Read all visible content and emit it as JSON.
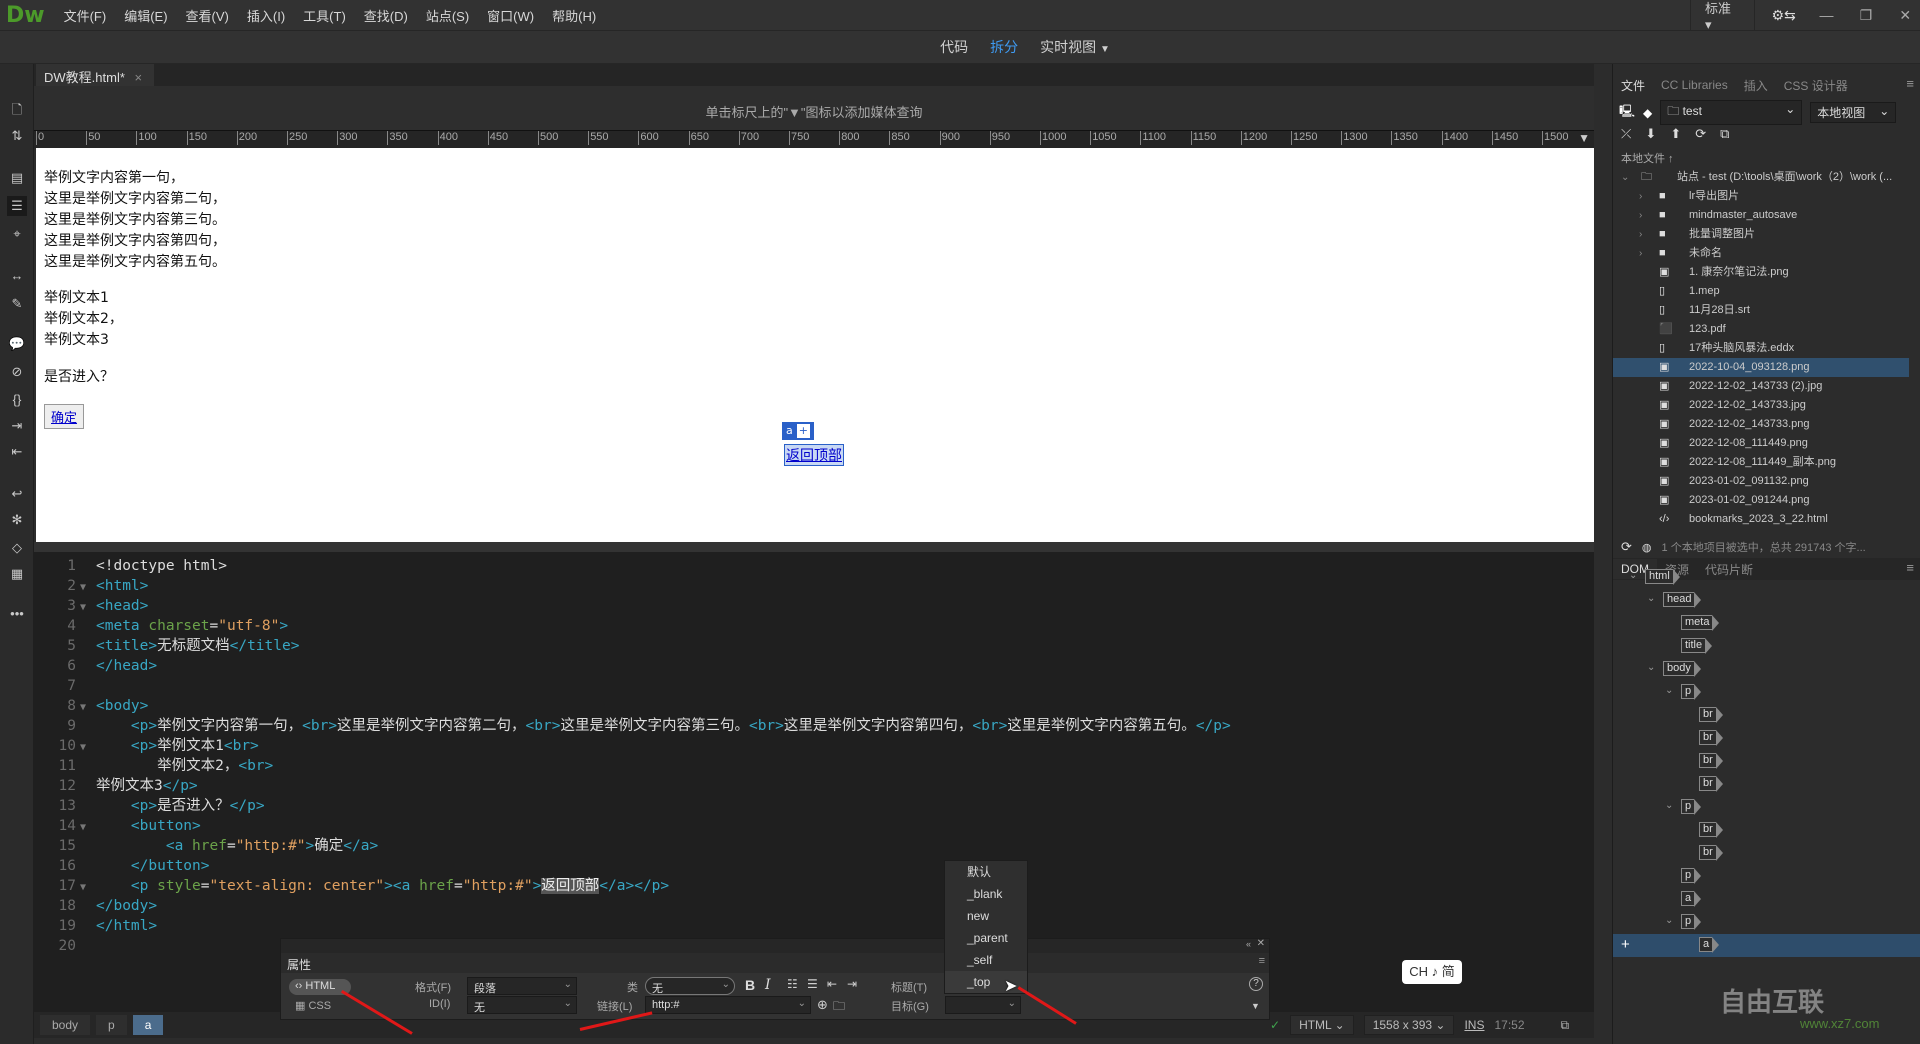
{
  "app": {
    "logo": "Dw",
    "workspace": "标准"
  },
  "menu": [
    "文件(F)",
    "编辑(E)",
    "查看(V)",
    "插入(I)",
    "工具(T)",
    "查找(D)",
    "站点(S)",
    "窗口(W)",
    "帮助(H)"
  ],
  "view_switch": {
    "code": "代码",
    "split": "拆分",
    "live": "实时视图",
    "active": "拆分"
  },
  "document_tab": {
    "name": "DW教程.html*",
    "close": "×"
  },
  "media_query_hint": "单击标尺上的\"▼\"图标以添加媒体查询",
  "ruler_ticks": [
    "0",
    "50",
    "100",
    "150",
    "200",
    "250",
    "300",
    "350",
    "400",
    "450",
    "500",
    "550",
    "600",
    "650",
    "700",
    "750",
    "800",
    "850",
    "900",
    "950",
    "1000",
    "1050",
    "1100",
    "1150",
    "1200",
    "1250",
    "1300",
    "1350",
    "1400",
    "1450",
    "1500"
  ],
  "design": {
    "para1": [
      "举例文字内容第一句，",
      "这里是举例文字内容第二句，",
      "这里是举例文字内容第三句。",
      "这里是举例文字内容第四句，",
      "这里是举例文字内容第五句。"
    ],
    "para2": [
      "举例文本1",
      "举例文本2，",
      "举例文本3"
    ],
    "para3": "是否进入？",
    "button_label": "确定",
    "selected_tag": "a",
    "selected_tag_add": "+",
    "back_to_top": "返回顶部"
  },
  "code_lines": [
    {
      "n": "1",
      "fold": "",
      "indent": "",
      "parts": [
        [
          "tx",
          "<!doctype html>"
        ]
      ]
    },
    {
      "n": "2",
      "fold": "▼",
      "indent": "",
      "parts": [
        [
          "tg",
          "<html>"
        ]
      ]
    },
    {
      "n": "3",
      "fold": "▼",
      "indent": "",
      "parts": [
        [
          "tg",
          "<head>"
        ]
      ]
    },
    {
      "n": "4",
      "fold": "",
      "indent": "",
      "parts": [
        [
          "tg",
          "<meta "
        ],
        [
          "at",
          "charset"
        ],
        [
          "tx",
          "="
        ],
        [
          "sv",
          "\"utf-8\""
        ],
        [
          "tg",
          ">"
        ]
      ]
    },
    {
      "n": "5",
      "fold": "",
      "indent": "",
      "parts": [
        [
          "tg",
          "<title>"
        ],
        [
          "tx",
          "无标题文档"
        ],
        [
          "tg",
          "</title>"
        ]
      ]
    },
    {
      "n": "6",
      "fold": "",
      "indent": "",
      "parts": [
        [
          "tg",
          "</head>"
        ]
      ]
    },
    {
      "n": "7",
      "fold": "",
      "indent": "",
      "parts": []
    },
    {
      "n": "8",
      "fold": "▼",
      "indent": "",
      "parts": [
        [
          "tg",
          "<body>"
        ]
      ]
    },
    {
      "n": "9",
      "fold": "",
      "indent": "    ",
      "parts": [
        [
          "tg",
          "<p>"
        ],
        [
          "tx",
          "举例文字内容第一句，"
        ],
        [
          "tg",
          "<br>"
        ],
        [
          "tx",
          "这里是举例文字内容第二句，"
        ],
        [
          "tg",
          "<br>"
        ],
        [
          "tx",
          "这里是举例文字内容第三句。"
        ],
        [
          "tg",
          "<br>"
        ],
        [
          "tx",
          "这里是举例文字内容第四句，"
        ],
        [
          "tg",
          "<br>"
        ],
        [
          "tx",
          "这里是举例文字内容第五句。"
        ],
        [
          "tg",
          "</p>"
        ]
      ]
    },
    {
      "n": "10",
      "fold": "▼",
      "indent": "    ",
      "parts": [
        [
          "tg",
          "<p>"
        ],
        [
          "tx",
          "举例文本1"
        ],
        [
          "tg",
          "<br>"
        ]
      ]
    },
    {
      "n": "11",
      "fold": "",
      "indent": "       ",
      "parts": [
        [
          "tx",
          "举例文本2，"
        ],
        [
          "tg",
          "<br>"
        ]
      ]
    },
    {
      "n": "12",
      "fold": "",
      "indent": "",
      "parts": [
        [
          "tx",
          "举例文本3"
        ],
        [
          "tg",
          "</p>"
        ]
      ]
    },
    {
      "n": "13",
      "fold": "",
      "indent": "    ",
      "parts": [
        [
          "tg",
          "<p>"
        ],
        [
          "tx",
          "是否进入？"
        ],
        [
          "tg",
          "</p>"
        ]
      ]
    },
    {
      "n": "14",
      "fold": "▼",
      "indent": "    ",
      "parts": [
        [
          "tg",
          "<button>"
        ]
      ]
    },
    {
      "n": "15",
      "fold": "",
      "indent": "        ",
      "parts": [
        [
          "tg",
          "<a "
        ],
        [
          "at",
          "href"
        ],
        [
          "tx",
          "="
        ],
        [
          "sv",
          "\"http:#\""
        ],
        [
          "tg",
          ">"
        ],
        [
          "tx",
          "确定"
        ],
        [
          "tg",
          "</a>"
        ]
      ]
    },
    {
      "n": "16",
      "fold": "",
      "indent": "    ",
      "parts": [
        [
          "tg",
          "</button>"
        ]
      ]
    },
    {
      "n": "17",
      "fold": "▼",
      "indent": "    ",
      "parts": [
        [
          "tg",
          "<p "
        ],
        [
          "at",
          "style"
        ],
        [
          "tx",
          "="
        ],
        [
          "sv",
          "\"text-align: center\""
        ],
        [
          "tg",
          ">"
        ],
        [
          "tg",
          "<a "
        ],
        [
          "at",
          "href"
        ],
        [
          "tx",
          "="
        ],
        [
          "sv",
          "\"http:#\""
        ],
        [
          "tg",
          ">"
        ],
        [
          "sel",
          "返回顶部"
        ],
        [
          "tg",
          "</a></p>"
        ]
      ]
    },
    {
      "n": "18",
      "fold": "",
      "indent": "",
      "parts": [
        [
          "tg",
          "</body>"
        ]
      ]
    },
    {
      "n": "19",
      "fold": "",
      "indent": "",
      "parts": [
        [
          "tg",
          "</html>"
        ]
      ]
    },
    {
      "n": "20",
      "fold": "",
      "indent": "",
      "parts": []
    }
  ],
  "breadcrumb": [
    "body",
    "p",
    "a"
  ],
  "statusbar": {
    "language": "HTML",
    "size": "1558 x 393",
    "mode": "INS",
    "position": "17:52"
  },
  "ime": "CH ♪ 简",
  "properties": {
    "title": "属性",
    "html_label": "HTML",
    "css_label": "CSS",
    "format_label": "格式(F)",
    "format_value": "段落",
    "id_label": "ID(I)",
    "id_value": "无",
    "class_label": "类",
    "class_value": "无",
    "link_label": "链接(L)",
    "link_value": "http:#",
    "title_label": "标题(T)",
    "target_label": "目标(G)",
    "target_value": "",
    "bold": "B",
    "italic": "I",
    "help": "?"
  },
  "target_dropdown": {
    "options": [
      "默认",
      "_blank",
      "new",
      "_parent",
      "_self",
      "_top"
    ],
    "highlighted": "_top"
  },
  "right_panel": {
    "tabs": [
      "文件",
      "CC Libraries",
      "插入",
      "CSS 设计器"
    ],
    "site_select": "test",
    "view_select": "本地视图",
    "local_files_header": "本地文件 ↑",
    "files": [
      {
        "name": "站点 - test (D:\\tools\\桌面\\work（2）\\work (...",
        "type": "site",
        "level": 0
      },
      {
        "name": "lr导出图片",
        "type": "folder",
        "level": 1
      },
      {
        "name": "mindmaster_autosave",
        "type": "folder",
        "level": 1
      },
      {
        "name": "批量调整图片",
        "type": "folder",
        "level": 1
      },
      {
        "name": "未命名",
        "type": "folder",
        "level": 1
      },
      {
        "name": "1. 康奈尔笔记法.png",
        "type": "image",
        "level": 1
      },
      {
        "name": "1.mep",
        "type": "file",
        "level": 1
      },
      {
        "name": "11月28日.srt",
        "type": "file",
        "level": 1
      },
      {
        "name": "123.pdf",
        "type": "pdf",
        "level": 1
      },
      {
        "name": "17种头脑风暴法.eddx",
        "type": "file",
        "level": 1
      },
      {
        "name": "2022-10-04_093128.png",
        "type": "image",
        "level": 1,
        "selected": true
      },
      {
        "name": "2022-12-02_143733 (2).jpg",
        "type": "image",
        "level": 1
      },
      {
        "name": "2022-12-02_143733.jpg",
        "type": "image",
        "level": 1
      },
      {
        "name": "2022-12-02_143733.png",
        "type": "image",
        "level": 1
      },
      {
        "name": "2022-12-08_111449.png",
        "type": "image",
        "level": 1
      },
      {
        "name": "2022-12-08_111449_副本.png",
        "type": "image",
        "level": 1
      },
      {
        "name": "2023-01-02_091132.png",
        "type": "image",
        "level": 1
      },
      {
        "name": "2023-01-02_091244.png",
        "type": "image",
        "level": 1
      },
      {
        "name": "bookmarks_2023_3_22.html",
        "type": "html",
        "level": 1
      }
    ],
    "files_status": "1 个本地项目被选中，总共 291743 个字...",
    "dom_tabs": [
      "DOM",
      "资源",
      "代码片断"
    ],
    "dom_tree": [
      {
        "tag": "html",
        "depth": 0,
        "expanded": true
      },
      {
        "tag": "head",
        "depth": 1,
        "expanded": true
      },
      {
        "tag": "meta",
        "depth": 2
      },
      {
        "tag": "title",
        "depth": 2
      },
      {
        "tag": "body",
        "depth": 1,
        "expanded": true
      },
      {
        "tag": "p",
        "depth": 2,
        "expanded": true
      },
      {
        "tag": "br",
        "depth": 3
      },
      {
        "tag": "br",
        "depth": 3
      },
      {
        "tag": "br",
        "depth": 3
      },
      {
        "tag": "br",
        "depth": 3
      },
      {
        "tag": "p",
        "depth": 2,
        "expanded": true
      },
      {
        "tag": "br",
        "depth": 3
      },
      {
        "tag": "br",
        "depth": 3
      },
      {
        "tag": "p",
        "depth": 2
      },
      {
        "tag": "a",
        "depth": 2
      },
      {
        "tag": "p",
        "depth": 2,
        "expanded": true
      },
      {
        "tag": "a",
        "depth": 3,
        "selected": true
      }
    ]
  },
  "watermark": {
    "brand": "自由互联",
    "url": "www.xz7.com"
  }
}
